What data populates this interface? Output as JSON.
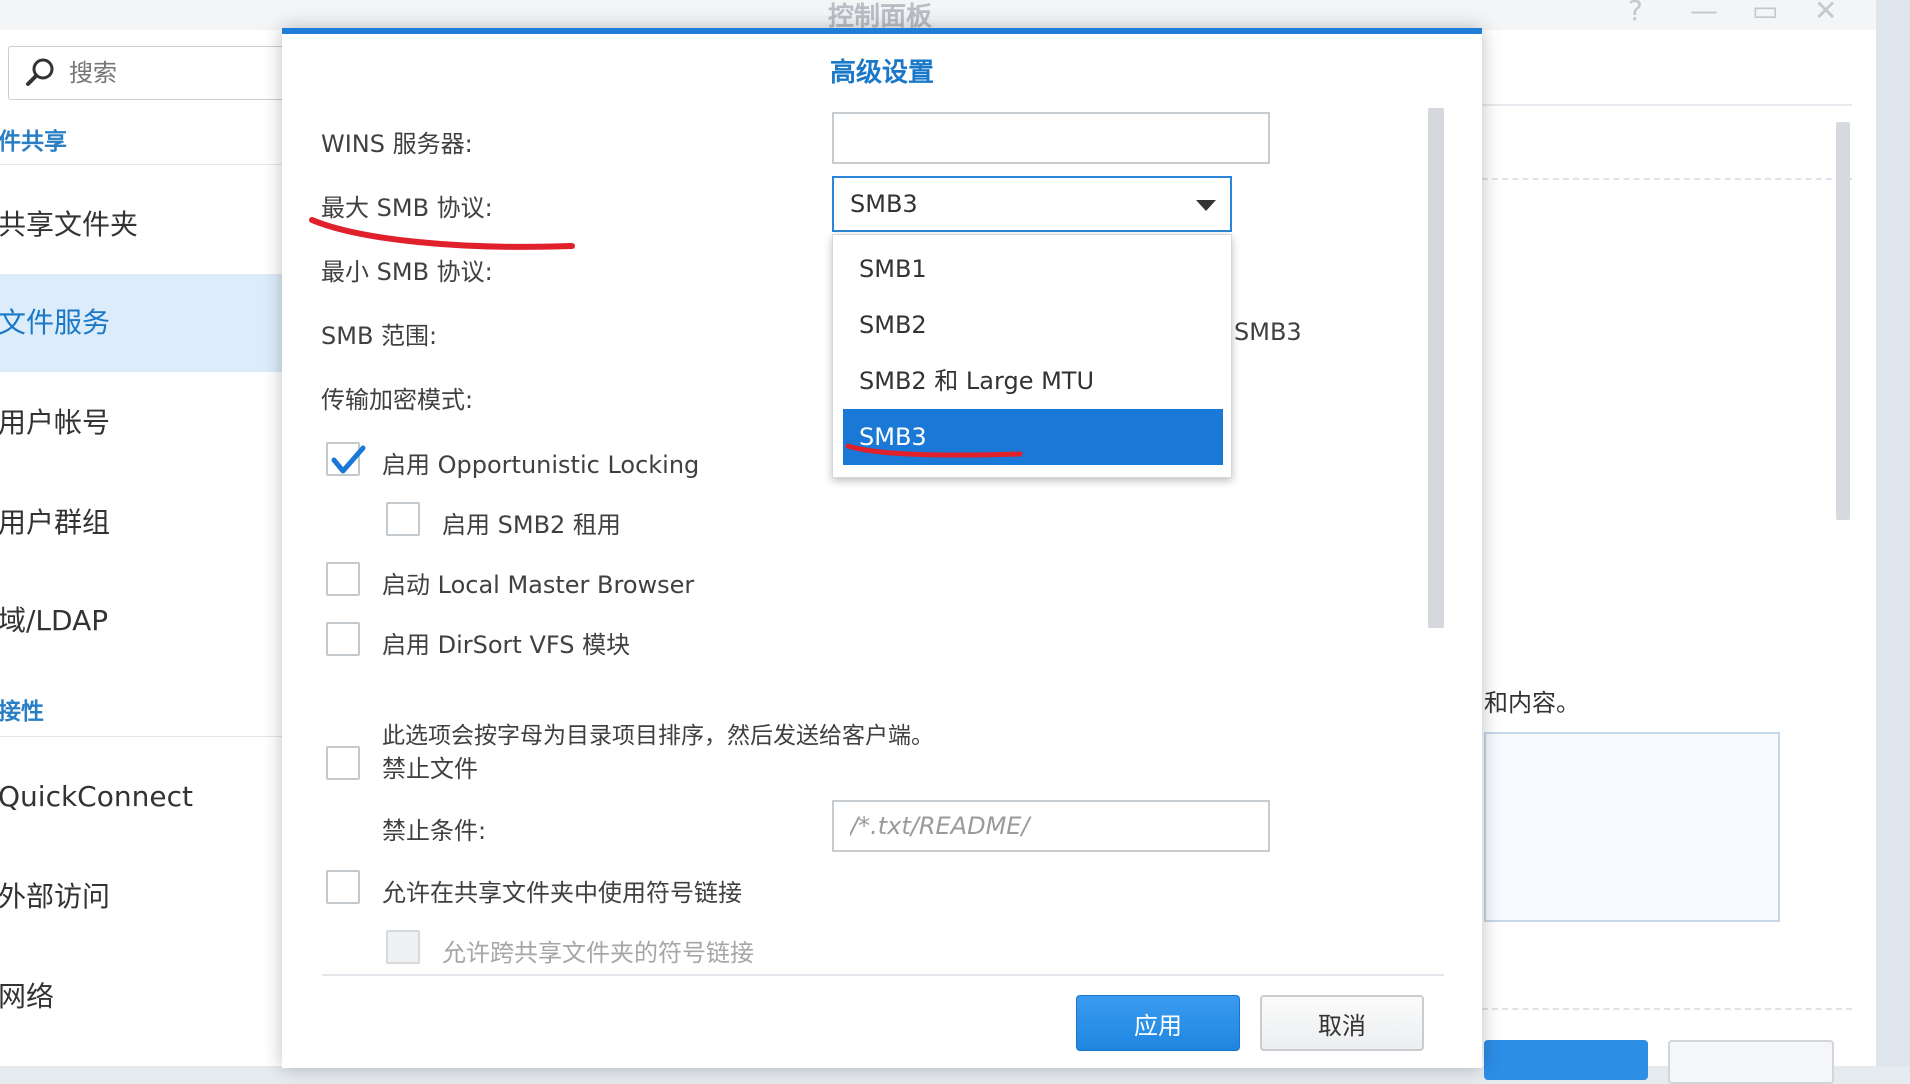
{
  "window": {
    "title": "控制面板",
    "help_glyph": "?",
    "minimize_glyph": "—",
    "maximize_glyph": "▭",
    "close_glyph": "✕"
  },
  "sidebar": {
    "search_placeholder": "搜索",
    "section_file_sharing": "件共享",
    "items": [
      {
        "label": "共享文件夹"
      },
      {
        "label": "文件服务"
      },
      {
        "label": "用户帐号"
      },
      {
        "label": "用户群组"
      },
      {
        "label": "域/LDAP"
      }
    ],
    "section_connectivity": "接性",
    "items2": [
      {
        "label": "QuickConnect"
      },
      {
        "label": "外部访问"
      },
      {
        "label": "网络"
      }
    ]
  },
  "background": {
    "partial_text": "和内容。"
  },
  "dialog": {
    "title": "高级设置",
    "wins_label": "WINS 服务器:",
    "wins_value": "",
    "max_smb_label": "最大 SMB 协议:",
    "max_smb_value": "SMB3",
    "min_smb_label": "最小 SMB 协议:",
    "smb_range_label": "SMB 范围:",
    "smb_range_suffix": "SMB3",
    "encrypt_label": "传输加密模式:",
    "dropdown_options": [
      "SMB1",
      "SMB2",
      "SMB2 和 Large MTU",
      "SMB3"
    ],
    "dropdown_selected": "SMB3",
    "opportunistic_label": "启用 Opportunistic Locking",
    "opportunistic_checked": true,
    "smb2_lease_label": "启用 SMB2 租用",
    "local_master_label": "启动 Local Master Browser",
    "dirsort_label": "启用 DirSort VFS 模块",
    "dirsort_desc": "此选项会按字母为目录项目排序，然后发送给客户端。",
    "veto_files_label": "禁止文件",
    "veto_condition_label": "禁止条件:",
    "veto_condition_placeholder": "/*.txt/README/",
    "symlink_label": "允许在共享文件夹中使用符号链接",
    "cross_symlink_label": "允许跨共享文件夹的符号链接",
    "apply_button": "应用",
    "cancel_button": "取消"
  },
  "colors": {
    "accent": "#1a78d6",
    "annotation": "#e0202a"
  }
}
